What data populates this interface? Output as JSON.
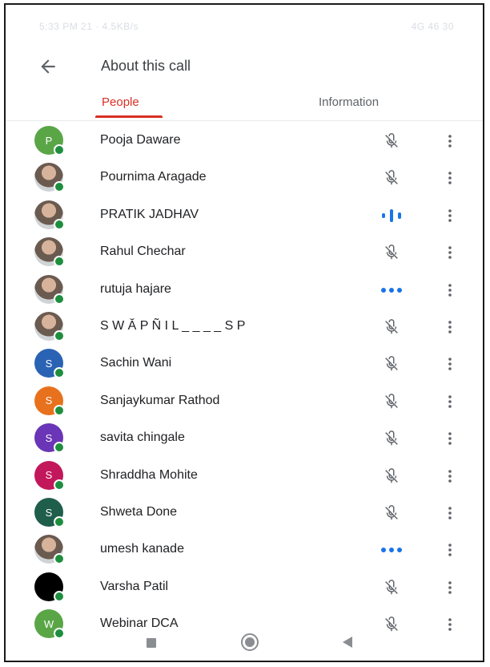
{
  "status_bar": {
    "left": "5:33 PM 21 · 4.5KB/s",
    "right": "4G 46 30"
  },
  "header": {
    "title": "About this call"
  },
  "tabs": [
    {
      "label": "People",
      "active": true
    },
    {
      "label": "Information",
      "active": false
    }
  ],
  "participants": [
    {
      "name": "Pooja Daware",
      "initial": "P",
      "avatar_color": "#5aa647",
      "photo": false,
      "status": "muted"
    },
    {
      "name": "Pournima Aragade",
      "initial": "",
      "avatar_color": "",
      "photo": true,
      "status": "muted"
    },
    {
      "name": "PRATIK JADHAV",
      "initial": "",
      "avatar_color": "",
      "photo": true,
      "status": "speaking"
    },
    {
      "name": "Rahul Chechar",
      "initial": "",
      "avatar_color": "",
      "photo": true,
      "status": "muted"
    },
    {
      "name": "rutuja hajare",
      "initial": "",
      "avatar_color": "",
      "photo": true,
      "status": "audio-dots"
    },
    {
      "name": "S W Ă P Ñ I L _ _ _ _ S P",
      "initial": "",
      "avatar_color": "",
      "photo": true,
      "status": "muted"
    },
    {
      "name": "Sachin Wani",
      "initial": "S",
      "avatar_color": "#2b63b4",
      "photo": false,
      "status": "muted"
    },
    {
      "name": "Sanjaykumar Rathod",
      "initial": "S",
      "avatar_color": "#e8711d",
      "photo": false,
      "status": "muted"
    },
    {
      "name": "savita chingale",
      "initial": "S",
      "avatar_color": "#6a35b6",
      "photo": false,
      "status": "muted"
    },
    {
      "name": "Shraddha Mohite",
      "initial": "S",
      "avatar_color": "#c2185b",
      "photo": false,
      "status": "muted"
    },
    {
      "name": "Shweta Done",
      "initial": "S",
      "avatar_color": "#1f5e4b",
      "photo": false,
      "status": "muted"
    },
    {
      "name": "umesh kanade",
      "initial": "",
      "avatar_color": "",
      "photo": true,
      "status": "audio-dots"
    },
    {
      "name": "Varsha Patil",
      "initial": "",
      "avatar_color": "#000000",
      "photo": false,
      "status": "muted"
    },
    {
      "name": "Webinar DCA",
      "initial": "W",
      "avatar_color": "#5aa647",
      "photo": false,
      "status": "muted"
    }
  ],
  "colors": {
    "accent": "#d93025",
    "speaking": "#1a73e8",
    "muted_icon": "#5f6368",
    "online": "#1e8e3e"
  },
  "icons": {
    "back": "arrow-left-icon",
    "muted": "mic-off-icon",
    "speaking": "audio-level-icon",
    "audio_dots": "audio-dots-icon",
    "more": "more-vertical-icon"
  },
  "nav_bar": [
    "recent-apps-button",
    "home-button",
    "back-button"
  ]
}
